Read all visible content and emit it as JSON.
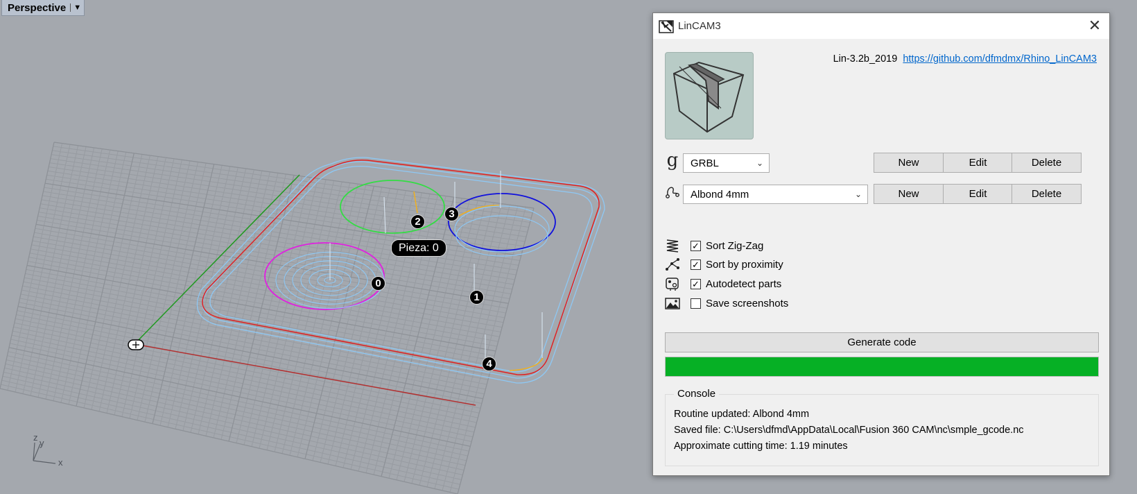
{
  "viewport": {
    "label": "Perspective",
    "dropdown_icon": "triangle-down",
    "axes": {
      "x": "x",
      "y": "y",
      "z": "z"
    },
    "markers": [
      "0",
      "1",
      "2",
      "3",
      "4"
    ],
    "piece_label": "Pieza: 0",
    "colors": {
      "outline_red": "#e02020",
      "toolpath_blue": "#8ec8f4",
      "circle_green": "#33dd44",
      "circle_blue": "#1010dd",
      "circle_magenta": "#e020e0",
      "leadin_orange": "#f0b020"
    }
  },
  "dialog": {
    "title": "LinCAM3",
    "version_text": "Lin-3.2b_2019",
    "link_text": "https://github.com/dfmdmx/Rhino_LinCAM3",
    "machine": {
      "icon": "g-code-icon",
      "selected": "GRBL",
      "new_label": "New",
      "edit_label": "Edit",
      "delete_label": "Delete"
    },
    "routine": {
      "icon": "toolpath-icon",
      "selected": "Albond 4mm",
      "new_label": "New",
      "edit_label": "Edit",
      "delete_label": "Delete"
    },
    "options": [
      {
        "label": "Sort Zig-Zag",
        "checked": true,
        "icon": "zigzag-icon"
      },
      {
        "label": "Sort by proximity",
        "checked": true,
        "icon": "proximity-icon"
      },
      {
        "label": "Autodetect parts",
        "checked": true,
        "icon": "parts-icon"
      },
      {
        "label": "Save screenshots",
        "checked": false,
        "icon": "screenshot-icon"
      }
    ],
    "generate_label": "Generate code",
    "progress": 1.0,
    "progress_color": "#06b025",
    "console": {
      "legend": "Console",
      "lines": [
        "Routine updated: Albond 4mm",
        "Saved file: C:\\Users\\dfmd\\AppData\\Local\\Fusion 360 CAM\\nc\\smple_gcode.nc",
        "Approximate cutting time: 1.19 minutes"
      ]
    }
  }
}
